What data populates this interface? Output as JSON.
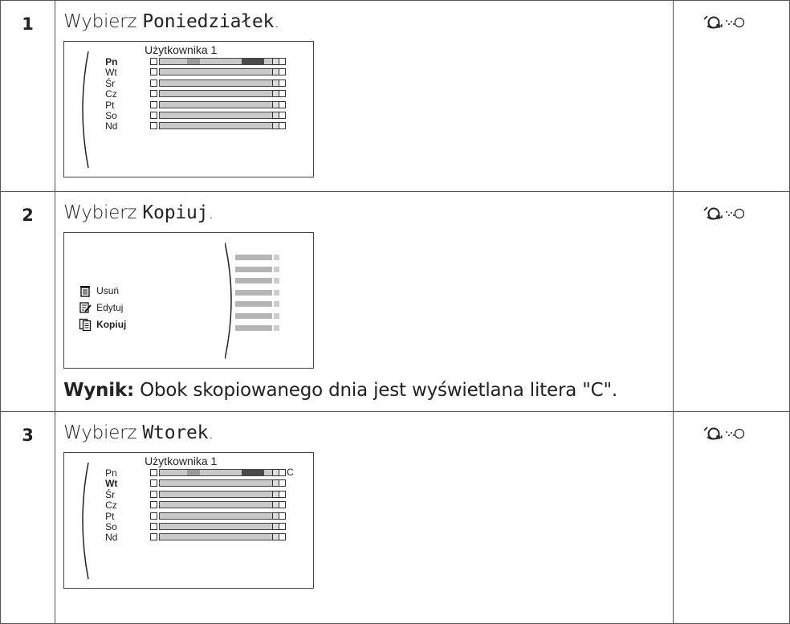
{
  "steps": [
    {
      "number": "1",
      "prefix": "Wybierz ",
      "keyword": "Poniedziałek",
      "suffix": ".",
      "screen": {
        "title": "Użytkownika 1",
        "days": [
          {
            "label": "Pn",
            "selected": true,
            "mark": ""
          },
          {
            "label": "Wt",
            "selected": false,
            "mark": ""
          },
          {
            "label": "Śr",
            "selected": false,
            "mark": ""
          },
          {
            "label": "Cz",
            "selected": false,
            "mark": ""
          },
          {
            "label": "Pt",
            "selected": false,
            "mark": ""
          },
          {
            "label": "So",
            "selected": false,
            "mark": ""
          },
          {
            "label": "Nd",
            "selected": false,
            "mark": ""
          }
        ]
      },
      "control_icon": "knob-turn-icon"
    },
    {
      "number": "2",
      "prefix": "Wybierz ",
      "keyword": "Kopiuj",
      "suffix": ".",
      "menu": [
        {
          "label": "Usuń",
          "icon": "trash-icon",
          "selected": false
        },
        {
          "label": "Edytuj",
          "icon": "edit-icon",
          "selected": false
        },
        {
          "label": "Kopiuj",
          "icon": "copy-icon",
          "selected": true
        }
      ],
      "result_label": "Wynik:",
      "result_text": " Obok skopiowanego dnia jest wyświetlana litera \"C\".",
      "control_icon": "knob-turn-icon"
    },
    {
      "number": "3",
      "prefix": "Wybierz ",
      "keyword": "Wtorek",
      "suffix": ".",
      "screen": {
        "title": "Użytkownika 1",
        "days": [
          {
            "label": "Pn",
            "selected": false,
            "mark": "C"
          },
          {
            "label": "Wt",
            "selected": true,
            "mark": ""
          },
          {
            "label": "Śr",
            "selected": false,
            "mark": ""
          },
          {
            "label": "Cz",
            "selected": false,
            "mark": ""
          },
          {
            "label": "Pt",
            "selected": false,
            "mark": ""
          },
          {
            "label": "So",
            "selected": false,
            "mark": ""
          },
          {
            "label": "Nd",
            "selected": false,
            "mark": ""
          }
        ]
      },
      "control_icon": "knob-turn-icon"
    }
  ],
  "colors": {
    "bar_fill": "#c9c9c9",
    "bar_mid": "#9a9a9a",
    "bar_dark": "#4a4a4a",
    "border": "#555555"
  }
}
